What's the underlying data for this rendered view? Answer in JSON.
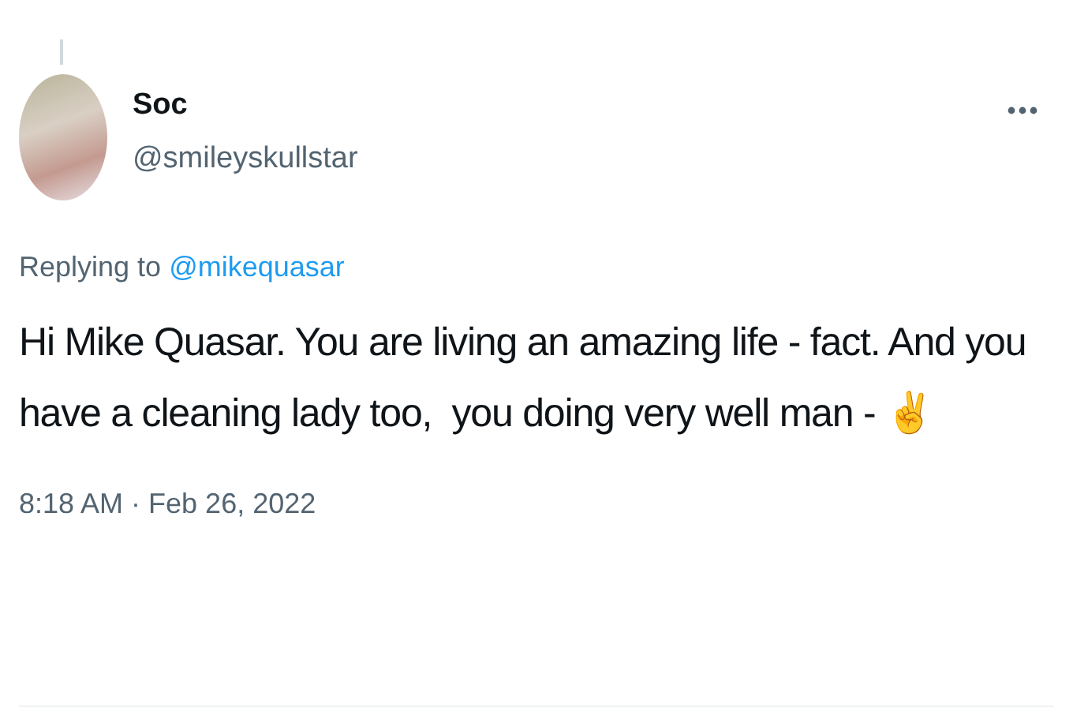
{
  "tweet": {
    "author": {
      "name": "Soc",
      "handle": "@smileyskullstar"
    },
    "reply": {
      "prefix": "Replying to",
      "mention": "@mikequasar"
    },
    "text": "Hi Mike Quasar. You are living an amazing life - fact. And you have a cleaning lady too,  you doing very well man - ✌️",
    "timestamp": "8:18 AM · Feb 26, 2022"
  }
}
